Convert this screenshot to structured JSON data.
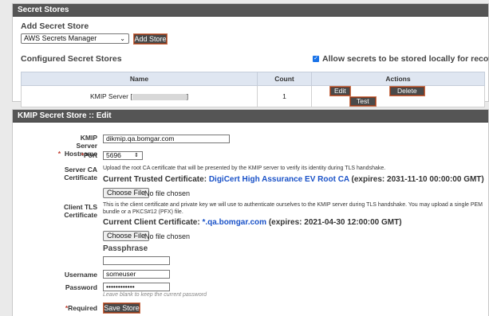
{
  "secret_stores": {
    "header": "Secret Stores",
    "add_title": "Add Secret Store",
    "store_type_value": "AWS Secrets Manager",
    "add_button": "Add Store",
    "configured_title": "Configured Secret Stores",
    "allow_local_label": "Allow secrets to be stored locally for recovery",
    "allow_local_checked": true,
    "table": {
      "columns": [
        "Name",
        "Count",
        "Actions"
      ],
      "rows": [
        {
          "name_prefix": "KMIP Server [",
          "name_suffix": "]",
          "count": "1",
          "actions": [
            "Edit",
            "Delete",
            "Test"
          ]
        }
      ]
    }
  },
  "kmip_edit": {
    "header": "KMIP Secret Store :: Edit",
    "hostname_label": "KMIP Server Hostname",
    "hostname_value": "dikmip.qa.bomgar.com",
    "port_label": "Port",
    "port_value": "5696",
    "server_ca_label": "Server CA Certificate",
    "server_ca_help": "Upload the root CA certificate that will be presented by the KMIP server to verify its identity during TLS handshake.",
    "trusted_cert_prefix": "Current Trusted Certificate: ",
    "trusted_cert_name": "DigiCert High Assurance EV Root CA",
    "trusted_cert_expiry": " (expires: 2031-11-10 00:00:00 GMT)",
    "choose_file_label": "Choose File",
    "no_file_label": "No file chosen",
    "client_tls_label": "Client TLS Certificate",
    "client_tls_help": "This is the client certificate and private key we will use to authenticate ourselves to the KMIP server during TLS handshake. You may upload a single PEM bundle or a PKCS#12 (PFX) file.",
    "client_cert_prefix": "Current Client Certificate: ",
    "client_cert_name": "*.qa.bomgar.com",
    "client_cert_expiry": " (expires: 2021-04-30 12:00:00 GMT)",
    "passphrase_label": "Passphrase",
    "username_label": "Username",
    "username_value": "someuser",
    "password_label": "Password",
    "password_value": "••••••••••••",
    "password_hint": "Leave blank to keep the current password",
    "required_label": "Required",
    "save_button": "Save Store"
  },
  "colors": {
    "header_bg": "#555555",
    "link_blue": "#1a52c8",
    "required_red": "#c0392b",
    "table_header_bg": "#dfe6f1"
  }
}
